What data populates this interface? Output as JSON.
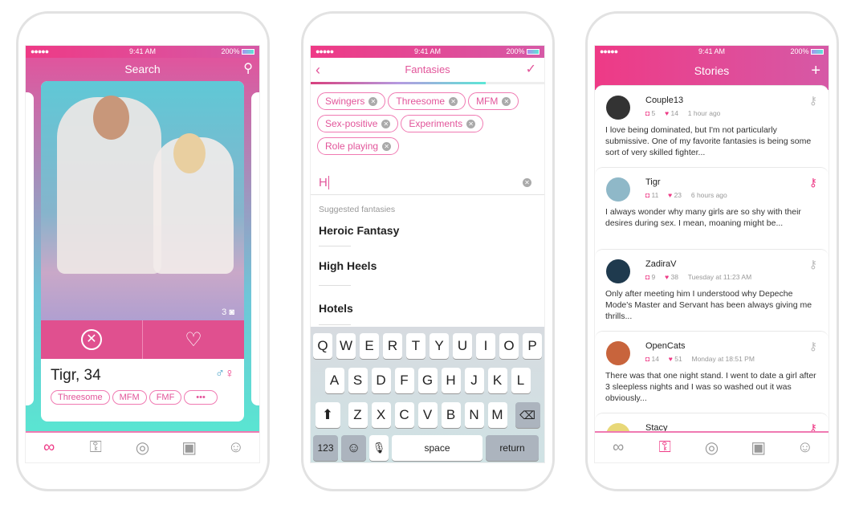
{
  "status": {
    "signal": "●●●●●",
    "time": "9:41 AM",
    "battery": "200%"
  },
  "search": {
    "title": "Search",
    "name_age": "Tigr, 34",
    "photo_count": "3",
    "tags": [
      "Threesome",
      "MFM",
      "FMF",
      "•••"
    ]
  },
  "fantasies": {
    "title": "Fantasies",
    "progress_percent": 75,
    "chips": [
      "Swingers",
      "Threesome",
      "MFM",
      "Sex-positive",
      "Experiments",
      "Role playing"
    ],
    "input_value": "H",
    "suggested_label": "Suggested fantasies",
    "suggestions": [
      "Heroic Fantasy",
      "High Heels",
      "Hotels"
    ],
    "keyboard": {
      "row1": [
        "Q",
        "W",
        "E",
        "R",
        "T",
        "Y",
        "U",
        "I",
        "O",
        "P"
      ],
      "row2": [
        "A",
        "S",
        "D",
        "F",
        "G",
        "H",
        "J",
        "K",
        "L"
      ],
      "row3": [
        "Z",
        "X",
        "C",
        "V",
        "B",
        "N",
        "M"
      ],
      "num": "123",
      "space": "space",
      "return": "return"
    }
  },
  "stories": {
    "title": "Stories",
    "items": [
      {
        "name": "Couple13",
        "comments": "5",
        "likes": "14",
        "time": "1 hour ago",
        "text": "I love being dominated, but I'm not particularly submissive. One of my favorite fantasies is being some sort of very skilled fighter...",
        "unlocked": false,
        "avatar_color": "#333"
      },
      {
        "name": "Tigr",
        "comments": "11",
        "likes": "23",
        "time": "6 hours ago",
        "text": "I always wonder why many girls are so shy with their desires during sex. I mean, moaning might be...",
        "unlocked": true,
        "avatar_color": "#8fb8c8"
      },
      {
        "name": "ZadiraV",
        "comments": "9",
        "likes": "38",
        "time": "Tuesday at 11:23 AM",
        "text": "Only after meeting him I understood why Depeche Mode's Master and Servant has been always giving me thrills...",
        "unlocked": false,
        "avatar_color": "#1f3a4e"
      },
      {
        "name": "OpenCats",
        "comments": "14",
        "likes": "51",
        "time": "Monday at 18:51 PM",
        "text": "There was that one night stand. I went to date a girl after 3 sleepless nights and I was so washed out it was obviously...",
        "unlocked": false,
        "avatar_color": "#c8643c"
      },
      {
        "name": "Stacy",
        "comments": "",
        "likes": "",
        "time": "",
        "text": "",
        "unlocked": true,
        "avatar_color": "#e8d878"
      }
    ]
  },
  "colors": {
    "accent": "#ee3a86",
    "teal": "#5ce6d6"
  }
}
